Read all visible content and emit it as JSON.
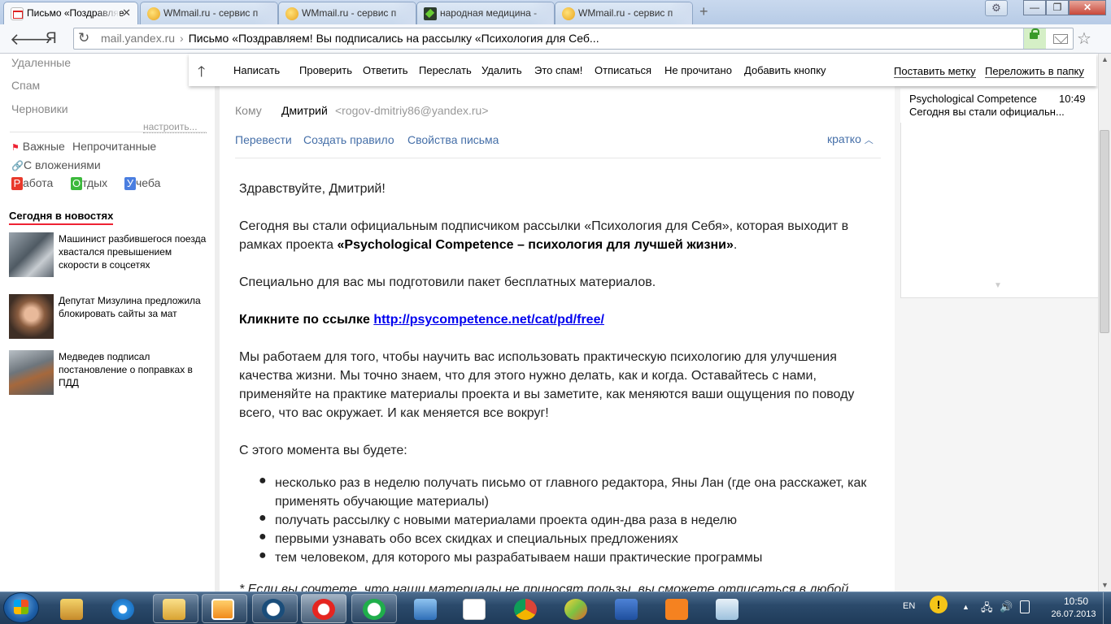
{
  "browser": {
    "tabs": [
      {
        "title": "Письмо «Поздравляе",
        "icon": "yandex-mail-icon",
        "active": true
      },
      {
        "title": "WMmail.ru - сервис п",
        "icon": "wmmail-icon",
        "active": false
      },
      {
        "title": "WMmail.ru - сервис п",
        "icon": "wmmail-icon",
        "active": false
      },
      {
        "title": "народная медицина -",
        "icon": "medicine-site-icon",
        "active": false
      },
      {
        "title": "WMmail.ru - сервис п",
        "icon": "wmmail-icon",
        "active": false
      }
    ],
    "tab_close": "✕",
    "new_tab": "+",
    "window_buttons": {
      "minimize": "—",
      "maximize": "❐",
      "close": "✕"
    },
    "address": {
      "host": "mail.yandex.ru",
      "separator": "›",
      "title": "Письмо «Поздравляем! Вы подписались на рассылку «Психология для Себ..."
    },
    "yandex_letter": "Я"
  },
  "sidebar": {
    "folders": [
      "Удаленные",
      "Спам",
      "Черновики"
    ],
    "configure": "настроить...",
    "filters": {
      "important": "Важные",
      "unread": "Непрочитанные",
      "attachments": "С вложениями"
    },
    "labels": [
      {
        "letter": "Р",
        "rest": "абота",
        "color": "#e8392b"
      },
      {
        "letter": "О",
        "rest": "тдых",
        "color": "#3cb93c"
      },
      {
        "letter": "У",
        "rest": "чеба",
        "color": "#4a7ee0"
      }
    ],
    "news_heading": "Сегодня в новостях",
    "news": [
      {
        "text": "Машинист разбившегося поезда хвастался превышением скорости в соцсетях"
      },
      {
        "text": "Депутат Мизулина предложила блокировать сайты за мат"
      },
      {
        "text": "Медведев подписал постановление о поправках в ПДД"
      }
    ]
  },
  "toolbar": {
    "write": "Написать",
    "check": "Проверить",
    "reply": "Ответить",
    "forward": "Переслать",
    "delete": "Удалить",
    "spam": "Это спам!",
    "unsubscribe": "Отписаться",
    "unread": "Не прочитано",
    "add_button": "Добавить кнопку",
    "set_label": "Поставить метку",
    "move_to_folder": "Переложить в папку"
  },
  "message": {
    "to_label": "Кому",
    "to_name": "Дмитрий",
    "to_email": "<rogov-dmitriy86@yandex.ru>",
    "actions": {
      "translate": "Перевести",
      "create_rule": "Создать правило",
      "properties": "Свойства письма"
    },
    "brief": "кратко",
    "greeting": "Здравствуйте, Дмитрий!",
    "p1_a": "Сегодня вы стали официальным подписчиком рассылки «Психология для Себя», которая выходит в рамках проекта ",
    "p1_b": "«Psychological Competence – психология для лучшей жизни»",
    "p1_c": ".",
    "p2": "Специально для вас мы подготовили пакет бесплатных материалов.",
    "p3_label": "Кликните по ссылке ",
    "p3_link": "http://psycompetence.net/cat/pd/free/",
    "p4": "Мы работаем для того, чтобы научить вас использовать практическую психологию для улучшения качества жизни. Мы точно знаем, что для этого нужно делать, как и когда. Оставайтесь с нами, применяйте на практике материалы проекта и вы заметите, как меняются ваши ощущения по поводу всего, что вас окружает. И как меняется все вокруг!",
    "p5": "С этого момента вы будете:",
    "bullets": [
      "несколько раз в неделю получать письмо от главного редактора, Яны Лан (где она расскажет, как применять обучающие материалы)",
      "получать рассылку с новыми материалами проекта один-два раза в неделю",
      "первыми узнавать обо всех скидках и специальных предложениях",
      "тем человеком, для которого мы разрабатываем наши практические программы"
    ],
    "footnote": "* Если вы сочтете, что наши материалы не приносят пользы, вы сможете отписаться в любой"
  },
  "thread": {
    "sender": "Psychological Competence",
    "time": "10:49",
    "snippet": "Сегодня вы стали официальн..."
  },
  "taskbar": {
    "lang": "EN",
    "time": "10:50",
    "date": "26.07.2013"
  }
}
